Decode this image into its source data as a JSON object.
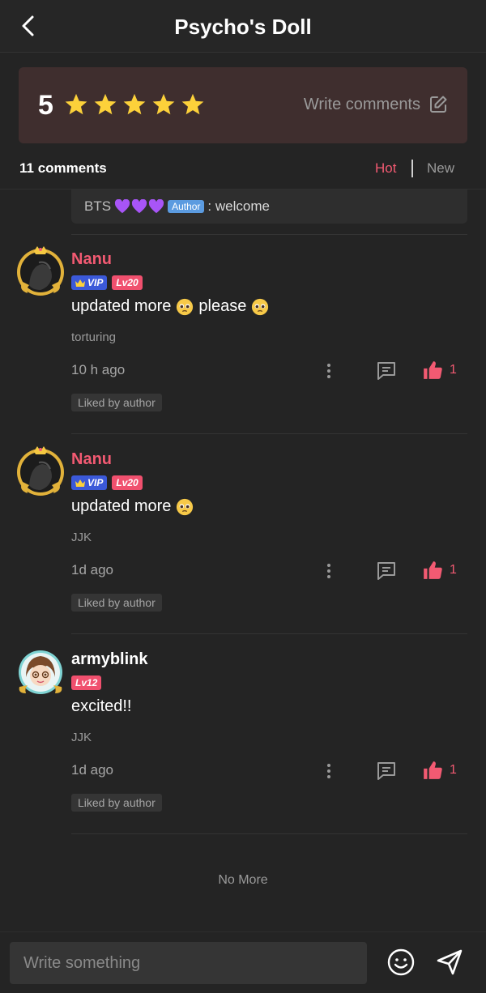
{
  "header": {
    "title": "Psycho's Doll",
    "back_icon": "back-arrow-icon"
  },
  "rating": {
    "score": "5",
    "stars": 5,
    "star_color": "#fcd13a",
    "write_label": "Write comments"
  },
  "comments_bar": {
    "count_label": "11 comments",
    "sort_hot": "Hot",
    "sort_new": "New",
    "active_sort": "Hot",
    "accent": "#f25a72"
  },
  "reply_preview": {
    "user": "BTS",
    "author_tag": "Author",
    "text": ": welcome"
  },
  "comments": [
    {
      "username": "Nanu",
      "username_color": "#f25a72",
      "vip": "VIP",
      "level": "Lv20",
      "text": "updated more",
      "text2": "please",
      "book": "torturing",
      "time": "10 h ago",
      "likes": "1",
      "liked_tag": "Liked by author"
    },
    {
      "username": "Nanu",
      "username_color": "#f25a72",
      "vip": "VIP",
      "level": "Lv20",
      "text": "updated more",
      "book": "JJK",
      "time": "1d ago",
      "likes": "1",
      "liked_tag": "Liked by author"
    },
    {
      "username": "armyblink",
      "username_color": "#ffffff",
      "level": "Lv12",
      "text": "excited!!",
      "book": "JJK",
      "time": "1d ago",
      "likes": "1",
      "liked_tag": "Liked by author"
    }
  ],
  "footer": {
    "no_more": "No More"
  },
  "input": {
    "placeholder": "Write something"
  }
}
